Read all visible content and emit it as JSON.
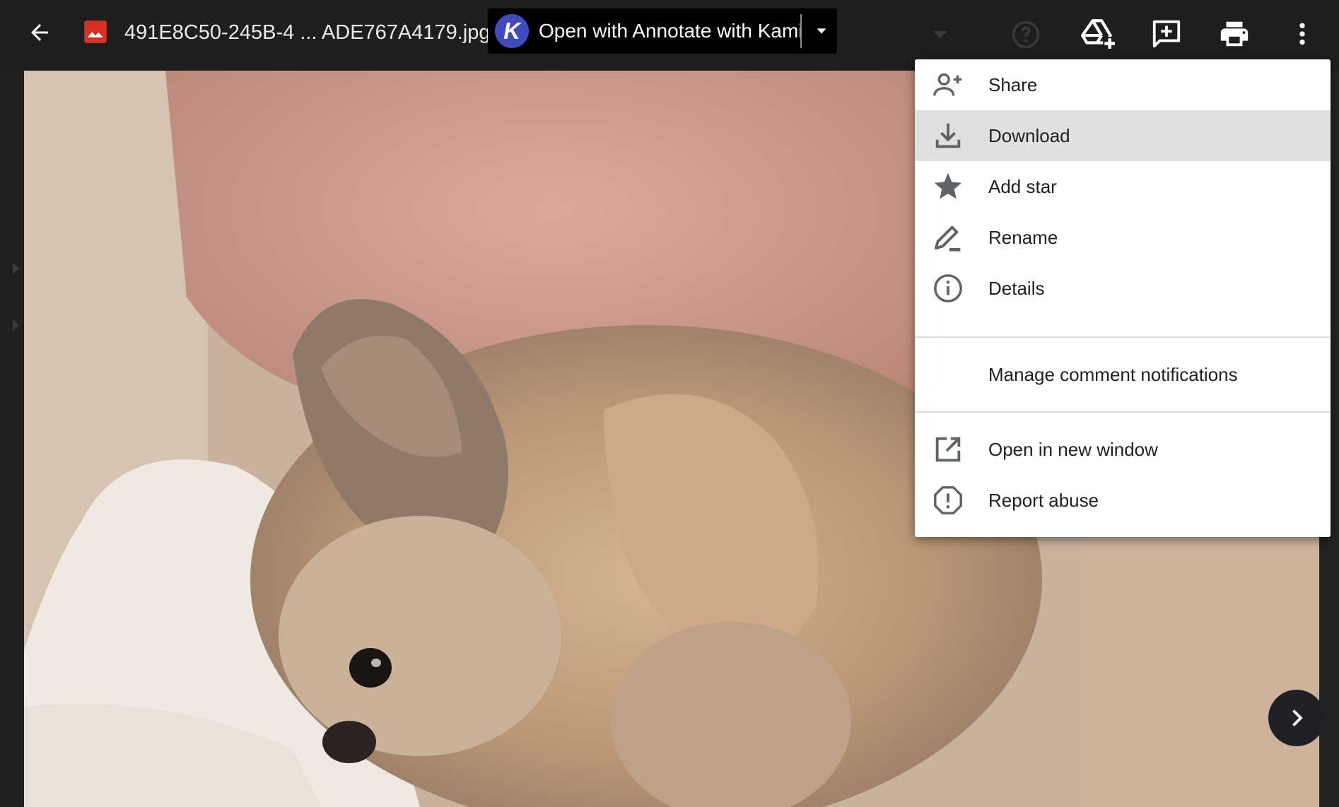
{
  "topbar": {
    "file_name": "491E8C50-245B-4 ... ADE767A4179.jpg",
    "open_with_label": "Open with Annotate with Kami",
    "open_with_logo_letter": "K",
    "accent_kami": "#3f4bbf",
    "icons": [
      "back-arrow-icon",
      "image-file-icon",
      "kami-logo-icon",
      "chevron-down-icon",
      "add-to-drive-icon",
      "add-comment-icon",
      "print-icon",
      "more-vert-icon"
    ]
  },
  "menu": {
    "items": [
      {
        "label": "Share",
        "icon": "person-add-icon"
      },
      {
        "label": "Download",
        "icon": "download-icon"
      },
      {
        "label": "Add star",
        "icon": "star-icon"
      },
      {
        "label": "Rename",
        "icon": "rename-pencil-icon"
      },
      {
        "label": "Details",
        "icon": "info-icon"
      }
    ],
    "section2": [
      {
        "label": "Manage comment notifications"
      }
    ],
    "section3": [
      {
        "label": "Open in new window",
        "icon": "open-in-new-icon"
      },
      {
        "label": "Report abuse",
        "icon": "report-icon"
      }
    ],
    "highlighted": "Download",
    "highlight_color": "#e0e0e0"
  },
  "viewer": {
    "next_button_icon": "chevron-right-icon"
  }
}
